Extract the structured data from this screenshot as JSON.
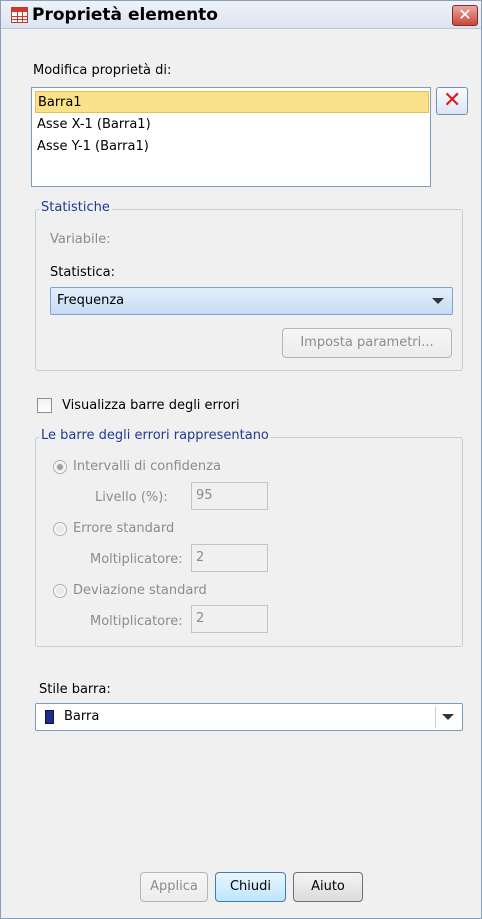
{
  "window": {
    "title": "Proprietà elemento",
    "close_label": "✕"
  },
  "edit_properties": {
    "label": "Modifica proprietà di:",
    "items": [
      {
        "label": "Barra1",
        "selected": true
      },
      {
        "label": "Asse X-1 (Barra1)",
        "selected": false
      },
      {
        "label": "Asse Y-1 (Barra1)",
        "selected": false
      }
    ],
    "delete_label": "✕"
  },
  "statistics": {
    "legend": "Statistiche",
    "variable_label": "Variabile:",
    "statistic_label": "Statistica:",
    "statistic_value": "Frequenza",
    "set_parameters_label": "Imposta parametri..."
  },
  "error_bars": {
    "show_label": "Visualizza barre degli errori",
    "show_checked": false,
    "legend": "Le barre degli errori rappresentano",
    "options": [
      {
        "label": "Intervalli di confidenza",
        "checked": true,
        "field_label": "Livello (%):",
        "field_value": "95"
      },
      {
        "label": "Errore standard",
        "checked": false,
        "field_label": "Moltiplicatore:",
        "field_value": "2"
      },
      {
        "label": "Deviazione standard",
        "checked": false,
        "field_label": "Moltiplicatore:",
        "field_value": "2"
      }
    ]
  },
  "bar_style": {
    "label": "Stile barra:",
    "value": "Barra",
    "swatch_color": "#1d2a8e"
  },
  "buttons": {
    "apply": "Applica",
    "close": "Chiudi",
    "help": "Aiuto"
  }
}
